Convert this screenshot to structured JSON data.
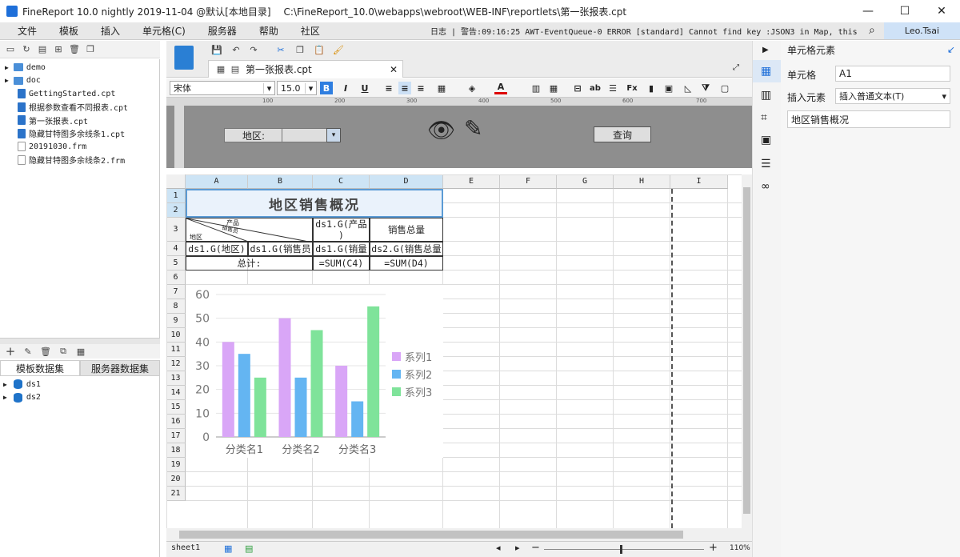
{
  "window": {
    "title": "FineReport 10.0 nightly 2019-11-04 @默认[本地目录]",
    "path": "C:\\FineReport_10.0\\webapps\\webroot\\WEB-INF\\reportlets\\第一张报表.cpt",
    "minimize": "—",
    "maximize": "☐",
    "close": "✕"
  },
  "menu": [
    "文件",
    "模板",
    "插入",
    "单元格(C)",
    "服务器",
    "帮助",
    "社区"
  ],
  "log": "日志 | 警告:09:16:25 AWT-EventQueue-0 ERROR [standard] Cannot find key :JSON3 in Map, this may ca...",
  "user": "Leo.Tsai",
  "tree": [
    {
      "name": "demo",
      "type": "folder"
    },
    {
      "name": "doc",
      "type": "folder"
    },
    {
      "name": "GettingStarted.cpt",
      "type": "cpt"
    },
    {
      "name": "根据参数查看不同报表.cpt",
      "type": "cpt"
    },
    {
      "name": "第一张报表.cpt",
      "type": "cpt"
    },
    {
      "name": "隐藏甘特图多余线条1.cpt",
      "type": "cpt"
    },
    {
      "name": "20191030.frm",
      "type": "frm"
    },
    {
      "name": "隐藏甘特图多余线条2.frm",
      "type": "frm"
    }
  ],
  "datasets": {
    "tab_template": "模板数据集",
    "tab_server": "服务器数据集",
    "items": [
      "ds1",
      "ds2"
    ]
  },
  "editor": {
    "tab": "第一张报表.cpt",
    "font": "宋体",
    "size": "15.0"
  },
  "ruler": [
    "100",
    "200",
    "300",
    "400",
    "500",
    "600",
    "700"
  ],
  "param": {
    "label": "地区:",
    "query": "查询"
  },
  "columns": [
    "A",
    "B",
    "C",
    "D",
    "E",
    "F",
    "G",
    "H",
    "I"
  ],
  "rows": [
    "1",
    "2",
    "3",
    "4",
    "5",
    "6",
    "7",
    "8",
    "9",
    "10",
    "11",
    "12",
    "13",
    "14",
    "15",
    "16",
    "17",
    "18",
    "19",
    "20",
    "21"
  ],
  "cells": {
    "title": "地区销售概况",
    "slash_product": "产品",
    "slash_seller": "销售员",
    "slash_region": "地区",
    "c3": "ds1.G(产品\n)",
    "d3": "销售总量",
    "a4": "ds1.G(地区)",
    "b4": "ds1.G(销售员",
    "c4": "ds1.G(销量",
    "d4": "ds2.G(销售总量",
    "ab5": "总计:",
    "c5": "=SUM(C4)",
    "d5": "=SUM(D4)"
  },
  "chart_data": {
    "type": "bar",
    "categories": [
      "分类名1",
      "分类名2",
      "分类名3"
    ],
    "series": [
      {
        "name": "系列1",
        "values": [
          40,
          50,
          30
        ],
        "color": "#d9a6f7"
      },
      {
        "name": "系列2",
        "values": [
          35,
          25,
          15
        ],
        "color": "#64b5f2"
      },
      {
        "name": "系列3",
        "values": [
          25,
          45,
          55
        ],
        "color": "#7fe39a"
      }
    ],
    "ylim": [
      0,
      60
    ],
    "yticks": [
      "0",
      "10",
      "20",
      "30",
      "40",
      "50",
      "60"
    ],
    "legend": "right"
  },
  "sheet": "sheet1",
  "zoom": "110%",
  "panel": {
    "title": "单元格元素",
    "cell_label": "单元格",
    "cell_value": "A1",
    "insert_label": "插入元素",
    "insert_value": "插入普通文本(T)",
    "content": "地区销售概况"
  }
}
